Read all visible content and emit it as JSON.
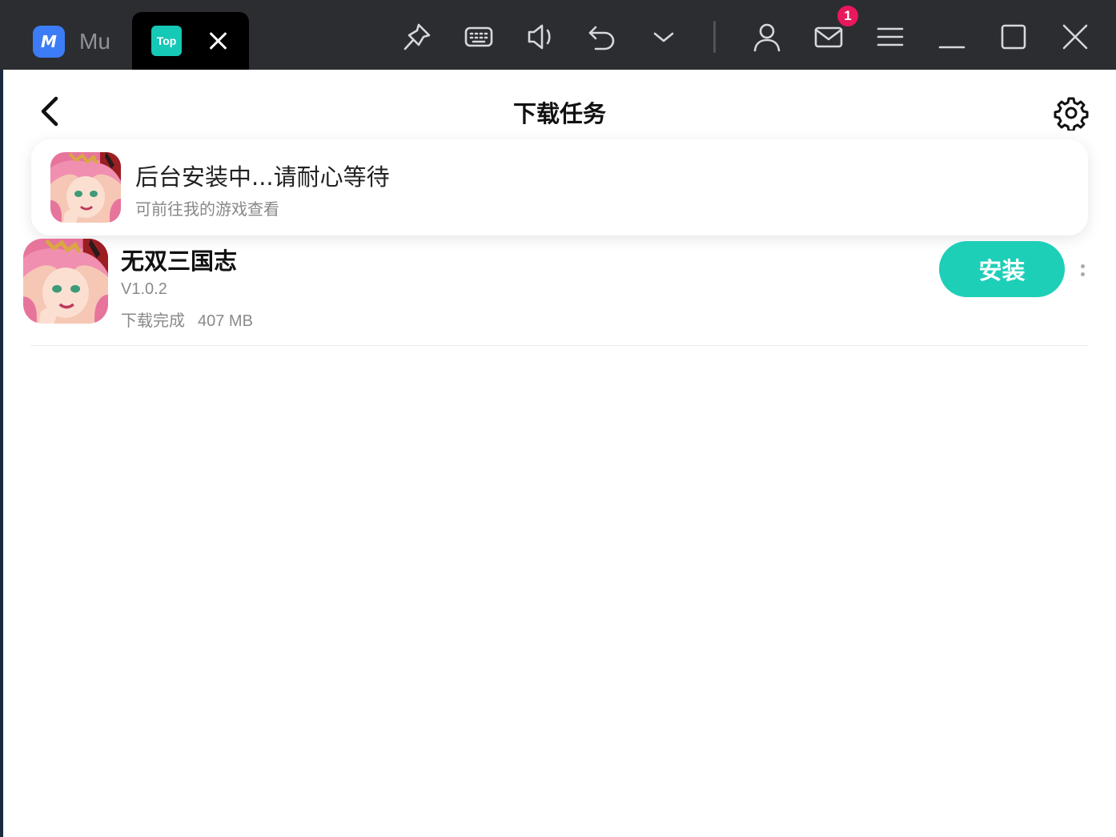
{
  "titlebar": {
    "tabs": [
      {
        "label": "Mu",
        "icon": "mumu-logo-icon"
      },
      {
        "label": "Top",
        "icon": "taptap-logo-icon"
      }
    ],
    "notification_count": "1",
    "icons": [
      "pin-icon",
      "keyboard-icon",
      "volume-icon",
      "undo-icon",
      "chevron-down-icon",
      "user-icon",
      "mail-icon",
      "menu-icon",
      "minimize-icon",
      "maximize-icon",
      "close-icon"
    ]
  },
  "header": {
    "title": "下载任务"
  },
  "toast": {
    "title": "后台安装中...请耐心等待",
    "subtitle": "可前往我的游戏查看"
  },
  "downloads": [
    {
      "name": "无双三国志",
      "version": "V1.0.2",
      "status": "下载完成",
      "size": "407 MB",
      "action_label": "安装"
    }
  ],
  "colors": {
    "accent": "#1ecfb8",
    "badge": "#e8185b",
    "titlebar_bg": "#2b2d31"
  }
}
